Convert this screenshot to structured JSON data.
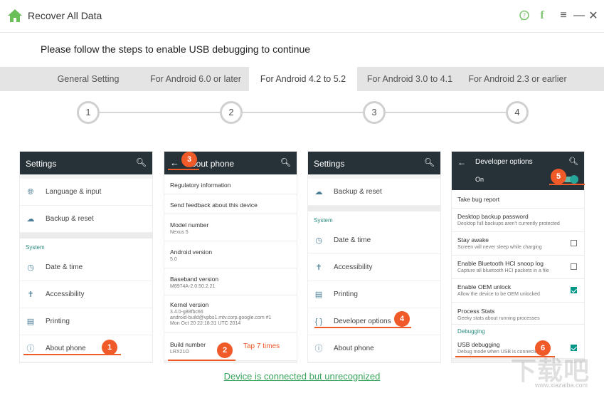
{
  "app": {
    "title": "Recover All Data"
  },
  "window_controls": {
    "feedback": "☺",
    "facebook": "f",
    "menu": "≡",
    "minimize": "—",
    "close": "✕"
  },
  "instruction": "Please follow the steps to enable USB debugging to continue",
  "tabs": [
    {
      "label": "General Setting",
      "active": false
    },
    {
      "label": "For Android 6.0 or later",
      "active": false
    },
    {
      "label": "For Android 4.2 to 5.2",
      "active": true
    },
    {
      "label": "For Android 3.0 to 4.1",
      "active": false
    },
    {
      "label": "For Android 2.3 or earlier",
      "active": false
    }
  ],
  "steps": [
    "1",
    "2",
    "3",
    "4"
  ],
  "panel1": {
    "title": "Settings",
    "items_top": [
      "Language & input",
      "Backup & reset"
    ],
    "section": "System",
    "items_bottom": [
      "Date & time",
      "Accessibility",
      "Printing",
      "About phone"
    ],
    "badge": "1"
  },
  "panel2": {
    "title": "About phone",
    "badge_back": "3",
    "badge_build": "2",
    "hint": "Tap 7 times",
    "items": [
      {
        "title": "Regulatory information",
        "sub": ""
      },
      {
        "title": "Send feedback about this device",
        "sub": ""
      },
      {
        "title": "Model number",
        "sub": "Nexus 5"
      },
      {
        "title": "Android version",
        "sub": "5.0"
      },
      {
        "title": "Baseband version",
        "sub": "M8974A-2.0.50.2.21"
      },
      {
        "title": "Kernel version",
        "sub": "3.4.0-g88fbc66\nandroid-build@vpbs1.mtv.corp.google.com #1\nMon Oct 20 22:18:31 UTC 2014"
      },
      {
        "title": "Build number",
        "sub": "LRX21O"
      }
    ]
  },
  "panel3": {
    "title": "Settings",
    "items_top": [
      "Backup & reset"
    ],
    "section": "System",
    "items_bottom": [
      "Date & time",
      "Accessibility",
      "Printing",
      "Developer options",
      "About phone"
    ],
    "badge": "4"
  },
  "panel4": {
    "title": "Developer options",
    "toggle_label": "On",
    "badge_toggle": "5",
    "badge_usb": "6",
    "items": [
      {
        "title": "Take bug report",
        "sub": "",
        "checkbox": "none"
      },
      {
        "title": "Desktop backup password",
        "sub": "Desktop full backups aren't currently protected",
        "checkbox": "none"
      },
      {
        "title": "Stay awake",
        "sub": "Screen will never sleep while charging",
        "checkbox": "off"
      },
      {
        "title": "Enable Bluetooth HCI snoop log",
        "sub": "Capture all bluetooth HCI packets in a file",
        "checkbox": "off"
      },
      {
        "title": "Enable OEM unlock",
        "sub": "Allow the device to be OEM unlocked",
        "checkbox": "on"
      },
      {
        "title": "Process Stats",
        "sub": "Geeky stats about running processes",
        "checkbox": "none"
      }
    ],
    "section": "Debugging",
    "usb_title": "USB debugging",
    "usb_sub": "Debug mode when USB is connected"
  },
  "status_link": "Device is connected but unrecognized",
  "watermark": {
    "main": "下载吧",
    "sub": "www.xiazaiba.com"
  },
  "colors": {
    "accent": "#f05a28",
    "green": "#3aa55c",
    "header": "#263238",
    "teal": "#009688"
  }
}
